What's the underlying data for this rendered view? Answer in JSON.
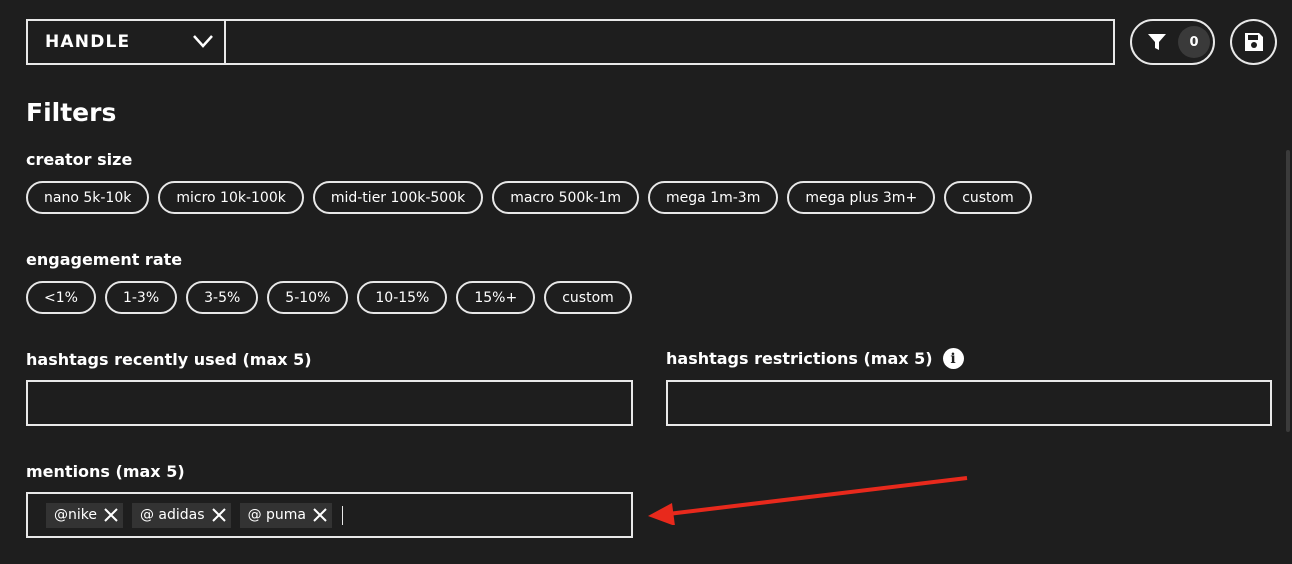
{
  "search": {
    "handle_label": "HANDLE",
    "query_value": "",
    "filter_count": "0"
  },
  "filters": {
    "title": "Filters",
    "creator_size": {
      "label": "creator size",
      "options": [
        "nano 5k-10k",
        "micro 10k-100k",
        "mid-tier 100k-500k",
        "macro 500k-1m",
        "mega 1m-3m",
        "mega plus 3m+",
        "custom"
      ]
    },
    "engagement_rate": {
      "label": "engagement rate",
      "options": [
        "<1%",
        "1-3%",
        "3-5%",
        "5-10%",
        "10-15%",
        "15%+",
        "custom"
      ]
    },
    "hashtags_used": {
      "label": "hashtags recently used (max 5)",
      "value": ""
    },
    "hashtags_restrictions": {
      "label": "hashtags restrictions (max 5)",
      "info_glyph": "i",
      "value": ""
    },
    "mentions": {
      "label": "mentions (max 5)",
      "tags": [
        "@nike",
        "@ adidas",
        "@ puma"
      ]
    }
  },
  "colors": {
    "background": "#1e1e1e",
    "border": "#e8e8e8",
    "tag_background": "#333333",
    "annotation_arrow": "#e8291c"
  },
  "icons": {
    "dropdown": "chevron-down-icon",
    "filter": "funnel-icon",
    "save": "floppy-disk-icon",
    "info": "info-icon",
    "remove_tag": "close-icon"
  }
}
